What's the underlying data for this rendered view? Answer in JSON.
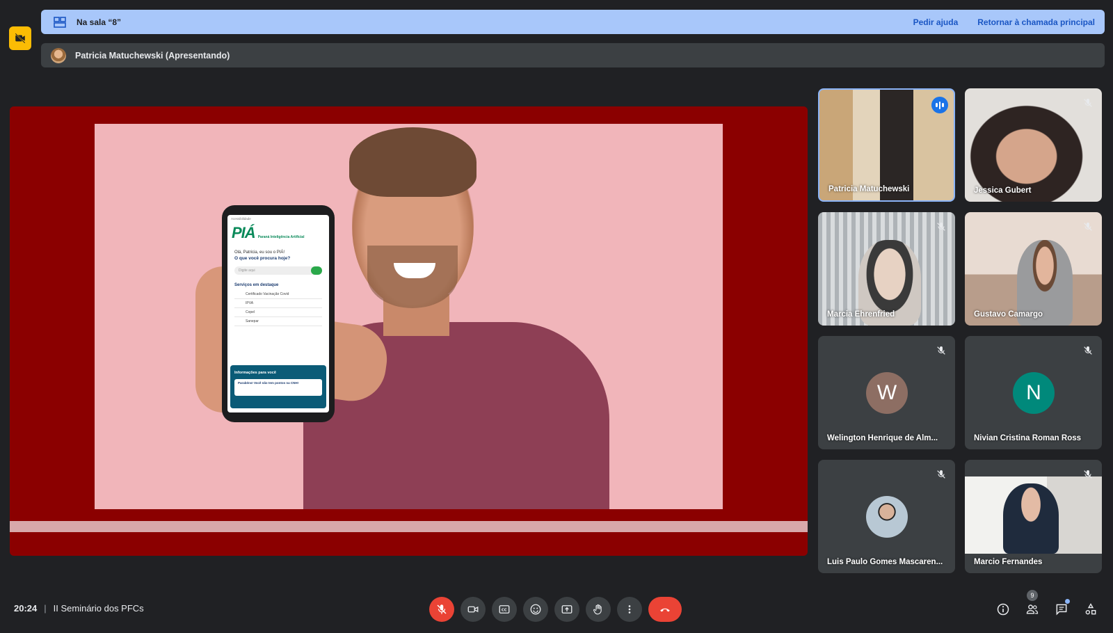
{
  "breakout": {
    "room_label": "Na sala “8”",
    "help_link": "Pedir ajuda",
    "return_link": "Retornar à chamada principal"
  },
  "presenter": {
    "label": "Patricia Matuchewski (Apresentando)"
  },
  "slide": {
    "phone_topline": "Acessibilidade",
    "logo_text": "PIÁ",
    "logo_subtext": "Paraná Inteligência Artificial",
    "greeting": "Olá, Patricia, eu sou o PIÁ!",
    "question": "O que você procura hoje?",
    "search_placeholder": "Digite aqui",
    "services_heading": "Serviços em destaque",
    "service_items": [
      "Certificado Vacinação Covid",
      "IPVA",
      "Copel",
      "Sanepar"
    ],
    "info_heading": "Informações para você",
    "info_card": "Parabéns! Você não tem pontos na CNH!"
  },
  "participants": [
    {
      "name": "Patricia Matuchewski",
      "speaking": true
    },
    {
      "name": "Jessica Gubert",
      "muted": true
    },
    {
      "name": "Marcia Ehrenfried",
      "muted": true
    },
    {
      "name": "Gustavo Camargo",
      "muted": true
    },
    {
      "name": "Welington Henrique de Alm...",
      "initial": "W",
      "avatar_color": "#8d6e63",
      "muted": true
    },
    {
      "name": "Nivian Cristina Roman Ross",
      "initial": "N",
      "avatar_color": "#00897b",
      "muted": true
    },
    {
      "name": "Luis Paulo Gomes Mascaren...",
      "muted": true
    },
    {
      "name": "Marcio Fernandes",
      "muted": true
    }
  ],
  "bottom": {
    "time": "20:24",
    "meeting_name": "II Seminário dos PFCs",
    "participant_count": "9"
  },
  "icons": [
    "camera-off-icon",
    "grid-icon",
    "mic-off-icon",
    "videocam-icon",
    "captions-icon",
    "emoji-icon",
    "present-icon",
    "raise-hand-icon",
    "more-icon",
    "hangup-icon",
    "info-icon",
    "people-icon",
    "chat-icon",
    "activities-icon"
  ],
  "colors": {
    "accent": "#8ab4f8",
    "danger": "#ea4335",
    "breakout_bar": "#a8c7fa",
    "slide_frame": "#8b0000"
  }
}
